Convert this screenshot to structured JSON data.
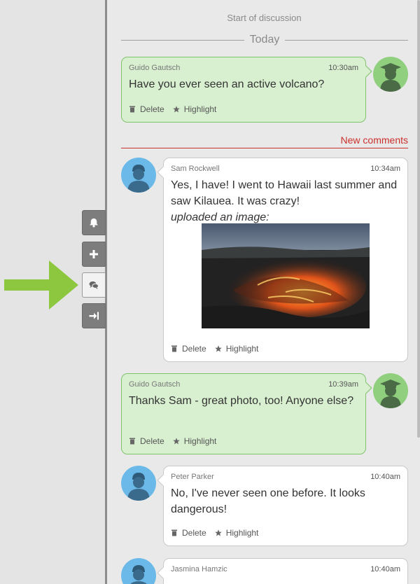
{
  "sidebar": {
    "buttons": [
      {
        "icon": "bell-icon",
        "active": false
      },
      {
        "icon": "plus-icon",
        "active": false
      },
      {
        "icon": "comments-icon",
        "active": true
      },
      {
        "icon": "collapse-right-icon",
        "active": false
      }
    ]
  },
  "discussion": {
    "start_label": "Start of discussion",
    "day_label": "Today",
    "new_comments_label": "New comments",
    "comments": [
      {
        "author": "Guido Gautsch",
        "time": "10:30am",
        "text": "Have you ever seen an active volcano?",
        "avatar": "graduate-avatar-icon",
        "style": "green"
      },
      {
        "author": "Sam Rockwell",
        "time": "10:34am",
        "text": "Yes, I have! I went to Hawaii last summer and saw Kilauea. It was crazy!",
        "note": "uploaded an image:",
        "avatar": "person-avatar-icon",
        "style": "white"
      },
      {
        "author": "Guido Gautsch",
        "time": "10:39am",
        "text": "Thanks Sam - great photo, too! Anyone else?",
        "avatar": "graduate-avatar-icon",
        "style": "green"
      },
      {
        "author": "Peter Parker",
        "time": "10:40am",
        "text": "No, I've never seen one before. It looks dangerous!",
        "avatar": "person-avatar-icon",
        "style": "white"
      },
      {
        "author": "Jasmina Hamzic",
        "time": "10:40am",
        "text": "",
        "avatar": "person-avatar-icon",
        "style": "white"
      }
    ],
    "actions": {
      "delete_label": "Delete",
      "highlight_label": "Highlight"
    }
  },
  "colors": {
    "accent_green": "#8dc63f",
    "new_comments_red": "#c9302c",
    "bubble_green": "#d8f0d0"
  }
}
